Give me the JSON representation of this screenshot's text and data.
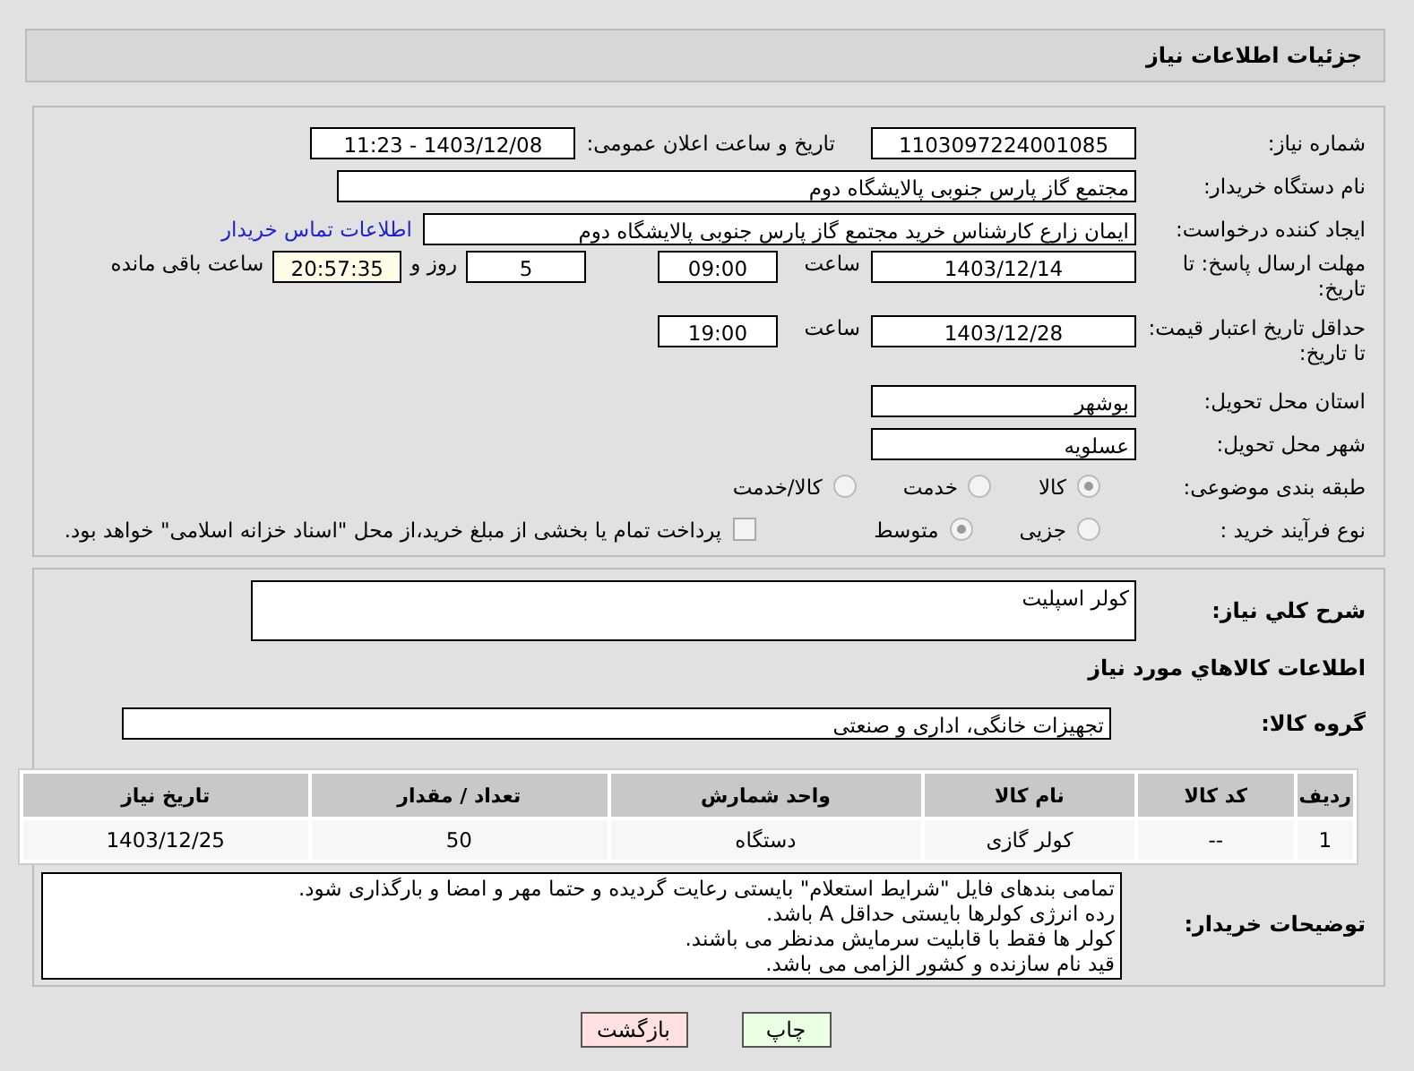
{
  "header": {
    "title": "جزئیات اطلاعات نیاز"
  },
  "need_number": {
    "label": "شماره نیاز:",
    "value": "1103097224001085"
  },
  "announce": {
    "label": "تاریخ و ساعت اعلان عمومی:",
    "value": "1403/12/08 - 11:23"
  },
  "buyer": {
    "label": "نام دستگاه خریدار:",
    "value": "مجتمع گاز پارس جنوبی  پالایشگاه دوم"
  },
  "creator": {
    "label": "ایجاد کننده درخواست:",
    "value": "ایمان زارع کارشناس خرید مجتمع گاز پارس جنوبی  پالایشگاه دوم",
    "link": "اطلاعات تماس خریدار"
  },
  "deadline": {
    "label": "مهلت ارسال پاسخ: تا تاریخ:",
    "date": "1403/12/14",
    "time_label": "ساعت",
    "time": "09:00",
    "days": "5",
    "days_label": "روز و",
    "remaining": "20:57:35",
    "remaining_label": "ساعت باقی مانده"
  },
  "validity": {
    "label": "حداقل تاریخ اعتبار قیمت: تا تاریخ:",
    "date": "1403/12/28",
    "time_label": "ساعت",
    "time": "19:00"
  },
  "province": {
    "label": "استان محل تحویل:",
    "value": "بوشهر"
  },
  "city": {
    "label": "شهر محل تحویل:",
    "value": "عسلویه"
  },
  "category": {
    "label": "طبقه بندی موضوعی:",
    "options": [
      {
        "label": "کالا",
        "selected": true
      },
      {
        "label": "خدمت",
        "selected": false
      },
      {
        "label": "کالا/خدمت",
        "selected": false
      }
    ]
  },
  "process": {
    "label": "نوع فرآیند خرید :",
    "options": [
      {
        "label": "جزیی",
        "selected": false
      },
      {
        "label": "متوسط",
        "selected": true
      }
    ],
    "treasury": {
      "label": "پرداخت تمام یا بخشی از مبلغ خرید،از محل \"اسناد خزانه اسلامی\" خواهد بود.",
      "checked": false
    }
  },
  "description": {
    "label": "شرح کلي نياز:",
    "value": "کولر اسپلیت"
  },
  "goods_heading": "اطلاعات کالاهاي مورد نياز",
  "goods_group": {
    "label": "گروه کالا:",
    "value": "تجهیزات خانگی، اداری و صنعتی"
  },
  "table": {
    "columns": [
      "ردیف",
      "کد کالا",
      "نام کالا",
      "واحد شمارش",
      "تعداد / مقدار",
      "تاریخ نیاز"
    ],
    "rows": [
      [
        "1",
        "--",
        "کولر گازی",
        "دستگاه",
        "50",
        "1403/12/25"
      ]
    ]
  },
  "notes": {
    "label": "توضیحات خریدار:",
    "lines": [
      "تمامی بندهای فایل \"شرایط استعلام\" بایستی رعایت گردیده و حتما مهر و امضا و بارگذاری شود.",
      "رده انرژی کولرها بایستی حداقل A باشد.",
      "کولر ها فقط با قابلیت سرمایش مدنظر می باشند.",
      "قید نام سازنده و کشور الزامی می باشد."
    ]
  },
  "buttons": [
    {
      "label": "چاپ",
      "kind": "print"
    },
    {
      "label": "بازگشت",
      "kind": "back"
    }
  ]
}
